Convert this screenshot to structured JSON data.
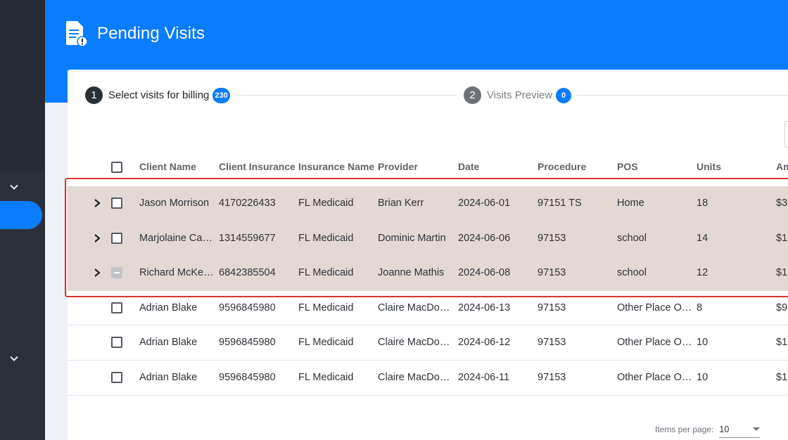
{
  "header": {
    "title": "Pending Visits",
    "icon": "document-alert-icon",
    "color": "#0a7cff"
  },
  "sidebar": {
    "chevrons": [
      "chevron-down-icon",
      "chevron-down-icon"
    ]
  },
  "stepper": {
    "steps": [
      {
        "number": "1",
        "label": "Select visits for billing",
        "badge": "230"
      },
      {
        "number": "2",
        "label": "Visits Preview",
        "badge": "0"
      }
    ]
  },
  "table": {
    "columns": [
      "Client Name",
      "Client Insurance",
      "Insurance Name",
      "Provider",
      "Date",
      "Procedure",
      "POS",
      "Units",
      "Am"
    ],
    "rows": [
      {
        "client": "Jason Morrison",
        "insurance": "4170226433",
        "insurance_name": "FL Medicaid",
        "provider": "Brian Kerr",
        "date": "2024-06-01",
        "procedure": "97151 TS",
        "pos": "Home",
        "units": "18",
        "amount": "$3"
      },
      {
        "client": "Marjolaine Ca…",
        "insurance": "1314559677",
        "insurance_name": "FL Medicaid",
        "provider": "Dominic Martin",
        "date": "2024-06-06",
        "procedure": "97153",
        "pos": "school",
        "units": "14",
        "amount": "$1"
      },
      {
        "client": "Richard McKen…",
        "insurance": "6842385504",
        "insurance_name": "FL Medicaid",
        "provider": "Joanne Mathis",
        "date": "2024-06-08",
        "procedure": "97153",
        "pos": "school",
        "units": "12",
        "amount": "$1"
      },
      {
        "client": "Adrian Blake",
        "insurance": "9596845980",
        "insurance_name": "FL Medicaid",
        "provider": "Claire MacDon…",
        "date": "2024-06-13",
        "procedure": "97153",
        "pos": "Other Place Of …",
        "units": "8",
        "amount": "$9"
      },
      {
        "client": "Adrian Blake",
        "insurance": "9596845980",
        "insurance_name": "FL Medicaid",
        "provider": "Claire MacDon…",
        "date": "2024-06-12",
        "procedure": "97153",
        "pos": "Other Place Of …",
        "units": "10",
        "amount": "$1"
      },
      {
        "client": "Adrian Blake",
        "insurance": "9596845980",
        "insurance_name": "FL Medicaid",
        "provider": "Claire MacDon…",
        "date": "2024-06-11",
        "procedure": "97153",
        "pos": "Other Place Of …",
        "units": "10",
        "amount": "$1"
      }
    ]
  },
  "pager": {
    "items_label": "Items per page:",
    "items_value": "10"
  }
}
